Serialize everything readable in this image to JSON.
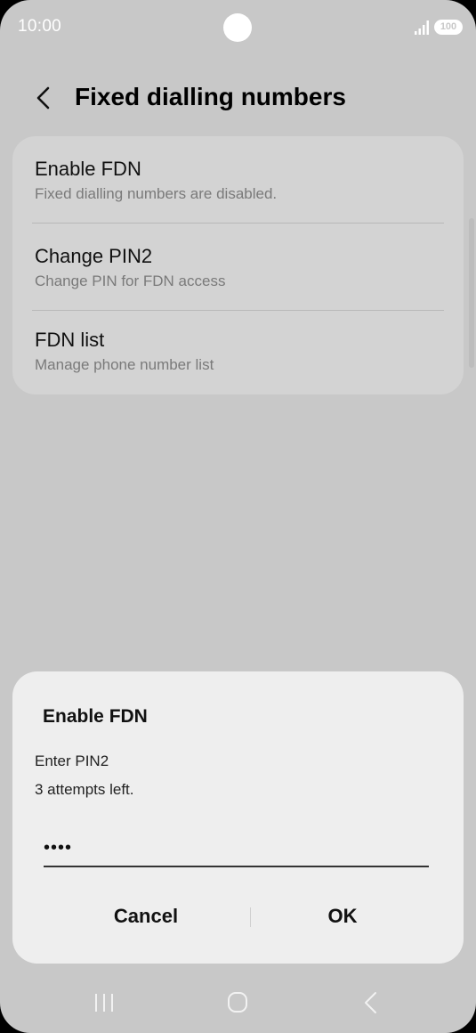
{
  "status_bar": {
    "time": "10:00",
    "battery": "100"
  },
  "header": {
    "title": "Fixed dialling numbers"
  },
  "settings": {
    "items": [
      {
        "title": "Enable FDN",
        "subtitle": "Fixed dialling numbers are disabled."
      },
      {
        "title": "Change PIN2",
        "subtitle": "Change PIN for FDN access"
      },
      {
        "title": "FDN list",
        "subtitle": "Manage phone number list"
      }
    ]
  },
  "dialog": {
    "title": "Enable FDN",
    "message_1": "Enter PIN2",
    "message_2": "3 attempts left.",
    "pin_value": "••••",
    "cancel_label": "Cancel",
    "ok_label": "OK"
  },
  "nav": {
    "icons": [
      "recent-apps-icon",
      "home-icon",
      "back-icon"
    ]
  },
  "colors": {
    "background": "#c8c8c8",
    "card": "#d3d3d3",
    "dialog": "#eeeeee"
  }
}
